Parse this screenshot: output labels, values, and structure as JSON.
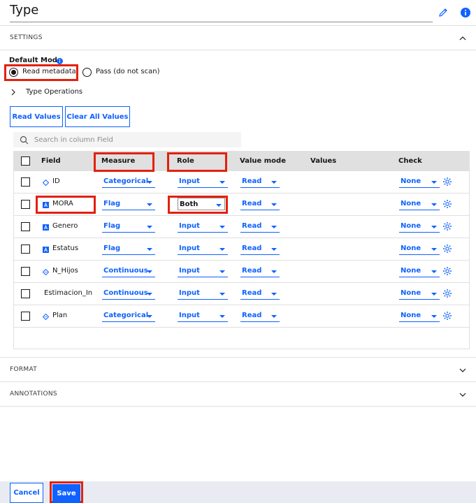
{
  "header": {
    "title": "Type",
    "edit_icon": "pencil-icon",
    "info_icon": "info-icon"
  },
  "sections": {
    "settings": "SETTINGS",
    "format": "FORMAT",
    "annotations": "ANNOTATIONS"
  },
  "default_mode": {
    "label": "Default Mode",
    "options": [
      {
        "label": "Read metadata",
        "checked": true
      },
      {
        "label": "Pass (do not scan)",
        "checked": false
      }
    ]
  },
  "type_operations": "Type Operations",
  "buttons": {
    "read_values": "Read Values",
    "clear_all_values": "Clear All Values",
    "cancel": "Cancel",
    "save": "Save"
  },
  "search": {
    "placeholder": "Search in column Field"
  },
  "table": {
    "columns": [
      "Field",
      "Measure",
      "Role",
      "Value mode",
      "Values",
      "Check"
    ],
    "rows": [
      {
        "field": "ID",
        "icon": "diamond-icon",
        "measure": "Categorical",
        "role": "Input",
        "value_mode": "Read",
        "values": "",
        "check": "None"
      },
      {
        "field": "MORA",
        "icon": "flag-icon",
        "measure": "Flag",
        "role": "Both",
        "value_mode": "Read",
        "values": "",
        "check": "None"
      },
      {
        "field": "Genero",
        "icon": "flag-icon",
        "measure": "Flag",
        "role": "Input",
        "value_mode": "Read",
        "values": "",
        "check": "None"
      },
      {
        "field": "Estatus",
        "icon": "flag-icon",
        "measure": "Flag",
        "role": "Input",
        "value_mode": "Read",
        "values": "",
        "check": "None"
      },
      {
        "field": "N_Hijos",
        "icon": "continuous-icon",
        "measure": "Continuous",
        "role": "Input",
        "value_mode": "Read",
        "values": "",
        "check": "None"
      },
      {
        "field": "Estimacion_In",
        "icon": "",
        "measure": "Continuous",
        "role": "Input",
        "value_mode": "Read",
        "values": "",
        "check": "None"
      },
      {
        "field": "Plan",
        "icon": "continuous-icon",
        "measure": "Categorical",
        "role": "Input",
        "value_mode": "Read",
        "values": "",
        "check": "None"
      }
    ]
  },
  "colors": {
    "accent": "#0f62fe",
    "highlight": "#e3200e",
    "header_bg": "#e0e0e0"
  }
}
